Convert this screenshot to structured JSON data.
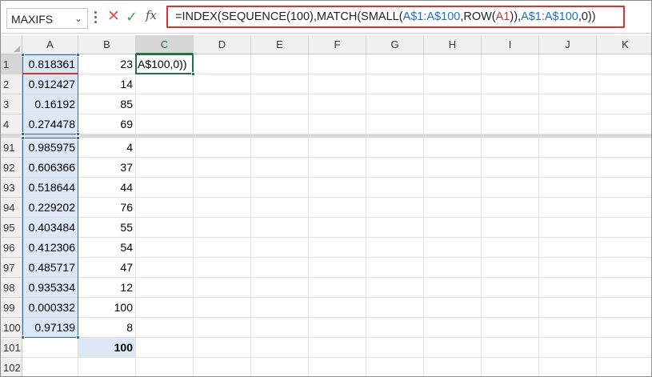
{
  "name_box": {
    "value": "MAXIFS"
  },
  "formula": {
    "parts": [
      {
        "text": "=INDEX(SEQUENCE(100),MATCH(SMALL(",
        "color": "#222222"
      },
      {
        "text": "A$1:A$100",
        "color": "#1f6fc5"
      },
      {
        "text": ",ROW(",
        "color": "#222222"
      },
      {
        "text": "A1",
        "color": "#c0392b"
      },
      {
        "text": ")),",
        "color": "#222222"
      },
      {
        "text": "A$1:A$100",
        "color": "#1f6fc5"
      },
      {
        "text": ",0))",
        "color": "#222222"
      }
    ]
  },
  "columns": [
    "A",
    "B",
    "C",
    "D",
    "E",
    "F",
    "G",
    "H",
    "I",
    "J",
    "K"
  ],
  "rows": [
    {
      "label": "1",
      "a": "0.818361",
      "b": "23",
      "c": "A$100,0))"
    },
    {
      "label": "2",
      "a": "0.912427",
      "b": "14"
    },
    {
      "label": "3",
      "a": "0.16192",
      "b": "85"
    },
    {
      "label": "4",
      "a": "0.274478",
      "b": "69"
    },
    {
      "label": "91",
      "a": "0.985975",
      "b": "4"
    },
    {
      "label": "92",
      "a": "0.606366",
      "b": "37"
    },
    {
      "label": "93",
      "a": "0.518644",
      "b": "44"
    },
    {
      "label": "94",
      "a": "0.229202",
      "b": "76"
    },
    {
      "label": "95",
      "a": "0.403484",
      "b": "55"
    },
    {
      "label": "96",
      "a": "0.412306",
      "b": "54"
    },
    {
      "label": "97",
      "a": "0.485717",
      "b": "47"
    },
    {
      "label": "98",
      "a": "0.935334",
      "b": "12"
    },
    {
      "label": "99",
      "a": "0.000332",
      "b": "100"
    },
    {
      "label": "100",
      "a": "0.97139",
      "b": "8"
    },
    {
      "label": "101",
      "a": "",
      "b": "100"
    },
    {
      "label": "102",
      "a": "",
      "b": ""
    }
  ],
  "colors": {
    "formula_border": "#e0312f",
    "range_highlight": "#dce8f5",
    "active_cell_border": "#217346",
    "range_border": "#2f6cc0"
  }
}
